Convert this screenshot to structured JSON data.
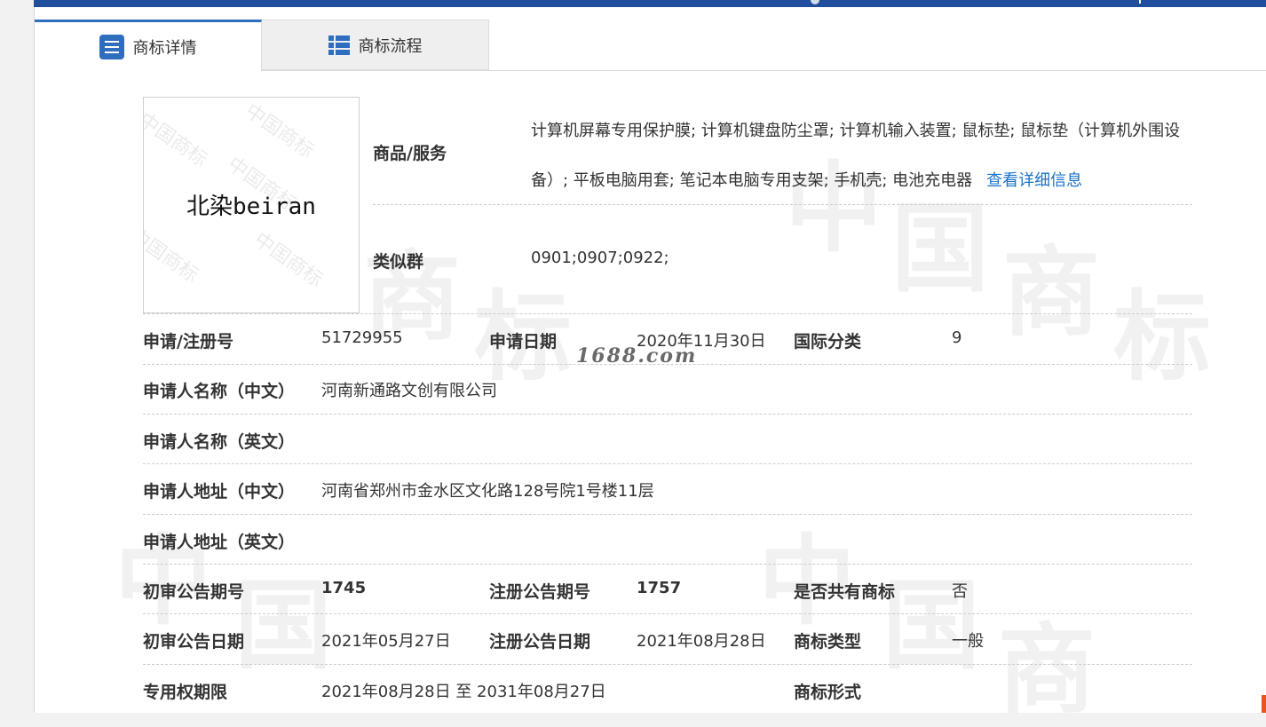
{
  "tabs": {
    "detail": "商标详情",
    "flow": "商标流程"
  },
  "mark": {
    "text": "北染beiran",
    "watermark": "中国商标"
  },
  "goods": {
    "label": "商品/服务",
    "text": "计算机屏幕专用保护膜; 计算机键盘防尘罩; 计算机输入装置; 鼠标垫; 鼠标垫（计算机外围设备）; 平板电脑用套; 笔记本电脑专用支架; 手机壳; 电池充电器",
    "link": "查看详细信息"
  },
  "similar": {
    "label": "类似群",
    "value": "0901;0907;0922;"
  },
  "rows": {
    "reg_no_label": "申请/注册号",
    "reg_no": "51729955",
    "apply_date_label": "申请日期",
    "apply_date": "2020年11月30日",
    "intl_class_label": "国际分类",
    "intl_class": "9",
    "applicant_cn_label": "申请人名称（中文）",
    "applicant_cn": "河南新通路文创有限公司",
    "applicant_en_label": "申请人名称（英文）",
    "applicant_en": "",
    "address_cn_label": "申请人地址（中文）",
    "address_cn": "河南省郑州市金水区文化路128号院1号楼11层",
    "address_en_label": "申请人地址（英文）",
    "address_en": "",
    "prelim_no_label": "初审公告期号",
    "prelim_no": "1745",
    "reg_pub_no_label": "注册公告期号",
    "reg_pub_no": "1757",
    "shared_label": "是否共有商标",
    "shared": "否",
    "prelim_date_label": "初审公告日期",
    "prelim_date": "2021年05月27日",
    "reg_pub_date_label": "注册公告日期",
    "reg_pub_date": "2021年08月28日",
    "mark_type_label": "商标类型",
    "mark_type": "一般",
    "term_label": "专用权期限",
    "term": "2021年08月28日 至 2031年08月27日",
    "mark_form_label": "商标形式",
    "mark_form": ""
  },
  "watermarks": {
    "site": "1688.com",
    "bg_chars": [
      "中",
      "国",
      "商",
      "标"
    ]
  },
  "colors": {
    "primary": "#2f6dbf",
    "link": "#1a73c6",
    "topbar": "#1f4f9c"
  }
}
